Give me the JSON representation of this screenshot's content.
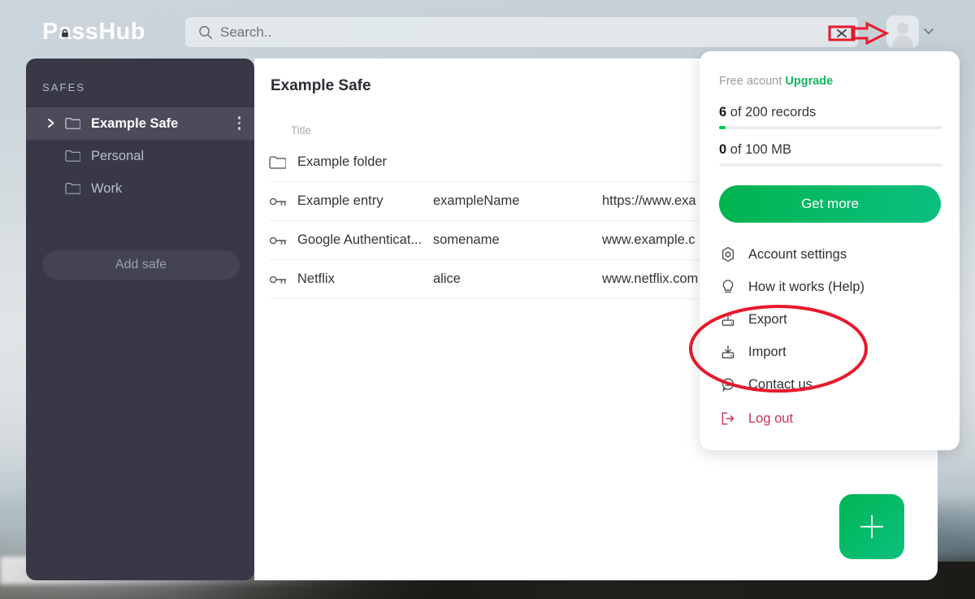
{
  "app": {
    "logo_text_before": "P",
    "logo_text_a": "a",
    "logo_text_after": "ssHub",
    "logo_full": "PassHub"
  },
  "search": {
    "placeholder": "Search..",
    "value": "",
    "icon": "search-icon",
    "clear_icon": "close-icon"
  },
  "account_button": {
    "avatar_icon": "user-avatar-icon",
    "chevron_icon": "chevron-down-icon"
  },
  "sidebar": {
    "section_title": "SAFES",
    "items": [
      {
        "label": "Example Safe",
        "icon": "folder-icon",
        "selected": true,
        "has_expand": true,
        "has_menu": true
      },
      {
        "label": "Personal",
        "icon": "folder-icon",
        "selected": false,
        "has_expand": false,
        "has_menu": false
      },
      {
        "label": "Work",
        "icon": "folder-icon",
        "selected": false,
        "has_expand": false,
        "has_menu": false
      }
    ],
    "add_safe_label": "Add safe"
  },
  "main": {
    "title": "Example Safe",
    "columns": [
      "Title"
    ],
    "rows": [
      {
        "icon": "folder-icon",
        "title": "Example folder",
        "username": "",
        "url": ""
      },
      {
        "icon": "key-icon",
        "title": "Example entry",
        "username": "exampleName",
        "url": "https://www.exa"
      },
      {
        "icon": "key-icon",
        "title": "Google Authenticat...",
        "username": "somename",
        "url": "www.example.c"
      },
      {
        "icon": "key-icon",
        "title": "Netflix",
        "username": "alice",
        "url": "www.netflix.com"
      }
    ],
    "add_button_icon": "plus-icon"
  },
  "dropdown": {
    "account_type": "Free acount",
    "upgrade_label": "Upgrade",
    "quota_records": {
      "used": "6",
      "rest": " of 200 records",
      "percent": 3
    },
    "quota_storage": {
      "used": "0",
      "rest": " of 100 MB",
      "percent": 0
    },
    "get_more_label": "Get more",
    "items": [
      {
        "label": "Account settings",
        "icon": "gear-icon"
      },
      {
        "label": "How it works (Help)",
        "icon": "lightbulb-icon"
      },
      {
        "label": "Export",
        "icon": "export-upload-icon"
      },
      {
        "label": "Import",
        "icon": "import-download-icon"
      },
      {
        "label": "Contact us",
        "icon": "chat-bubble-icon"
      },
      {
        "label": "Log out",
        "icon": "logout-icon"
      }
    ]
  },
  "annotations": {
    "ellipse_color": "#e8192c",
    "arrow_color": "#e8192c"
  },
  "colors": {
    "accent_green": "#00c853",
    "brand_green": "#12b760",
    "logout_red": "#cf3050",
    "sidebar_bg": "#383846",
    "sidebar_selected": "#4b4b59"
  }
}
